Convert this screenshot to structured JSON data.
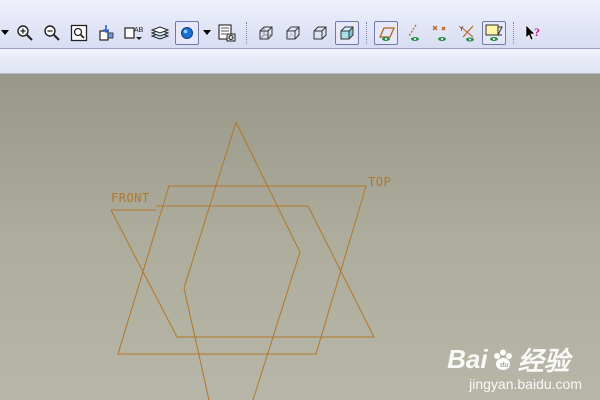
{
  "toolbar": {
    "buttons": [
      {
        "name": "zoom-in-icon"
      },
      {
        "name": "zoom-out-icon"
      },
      {
        "name": "refit-icon"
      },
      {
        "name": "reorient-icon"
      },
      {
        "name": "saved-views-icon"
      },
      {
        "name": "layers-icon"
      },
      {
        "name": "display-style-icon"
      },
      {
        "name": "view-manager-icon"
      },
      {
        "name": "wireframe-icon"
      },
      {
        "name": "hidden-line-icon"
      },
      {
        "name": "no-hidden-icon"
      },
      {
        "name": "shading-icon"
      },
      {
        "name": "datum-plane-display-icon"
      },
      {
        "name": "datum-axis-display-icon"
      },
      {
        "name": "datum-point-display-icon"
      },
      {
        "name": "coordinate-system-display-icon"
      },
      {
        "name": "annotation-display-icon"
      },
      {
        "name": "context-help-icon"
      }
    ],
    "pressed": [
      "shading-icon",
      "datum-plane-display-icon",
      "annotation-display-icon"
    ],
    "colors": {
      "bar": "#d9ddf3",
      "accent": "#1a6fd1"
    }
  },
  "viewport": {
    "background": "#aeac9c",
    "plane_color": "#b2772a",
    "labels": {
      "front": "FRONT",
      "top": "TOP"
    }
  },
  "watermark": {
    "brand_left": "Bai",
    "brand_right": "经验",
    "url": "jingyan.baidu.com"
  }
}
